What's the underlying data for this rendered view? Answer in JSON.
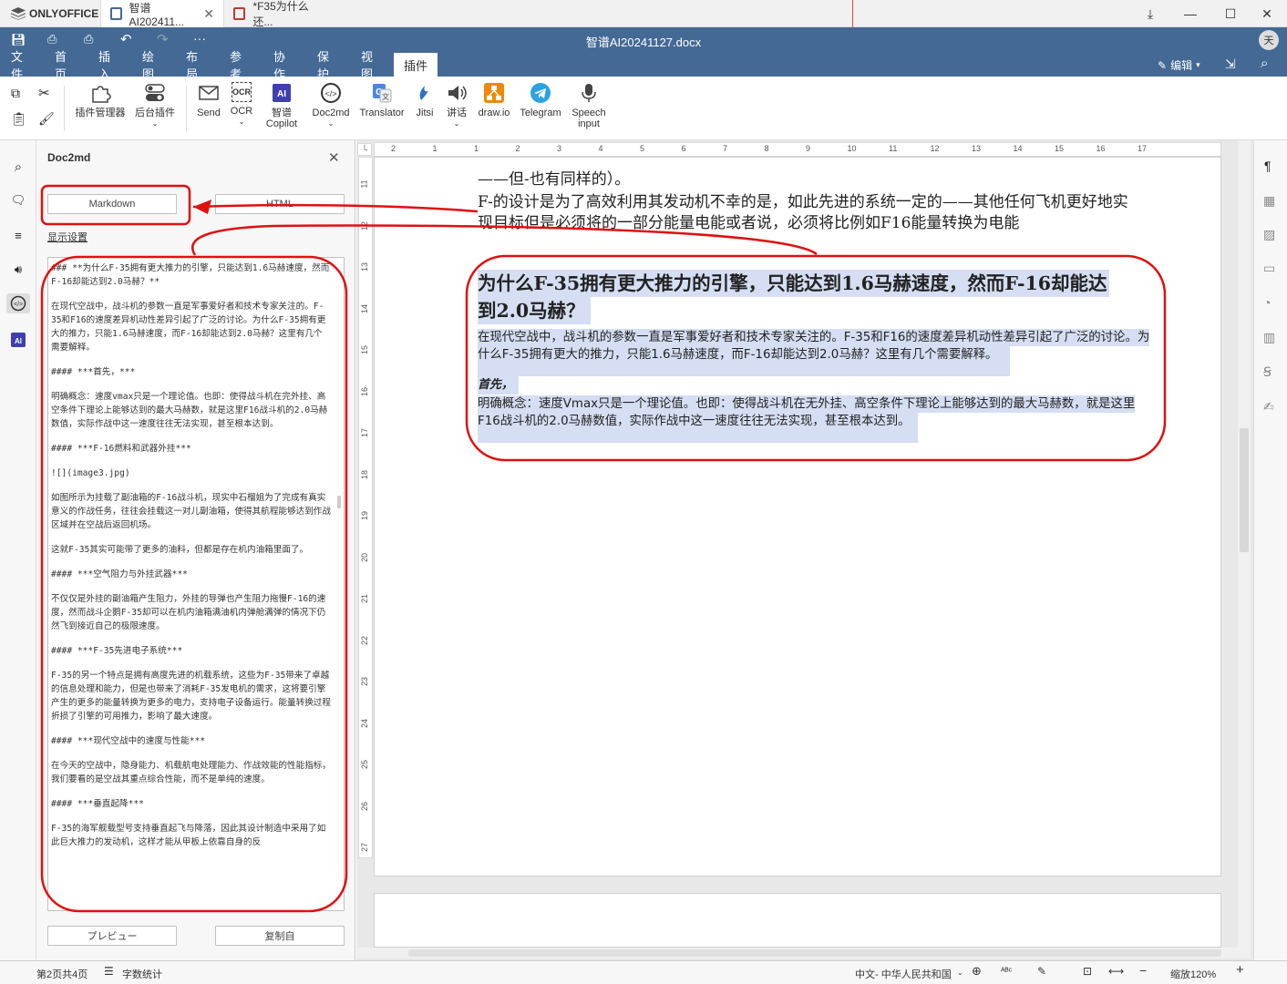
{
  "titlebar": {
    "app_name": "ONLYOFFICE",
    "tabs": [
      {
        "label": "智谱AI202411..."
      },
      {
        "label": "*F35为什么还..."
      }
    ]
  },
  "header": {
    "doc_title": "智谱AI20241127.docx",
    "avatar": "天",
    "edit_label": "编辑"
  },
  "menu": {
    "items": [
      "文件",
      "首页",
      "插入",
      "绘图",
      "布局",
      "参考",
      "协作",
      "保护",
      "视图",
      "插件"
    ],
    "active": "插件"
  },
  "toolbar": {
    "plugin_manager": "插件管理器",
    "background_plugins": "后台插件",
    "send": "Send",
    "ocr": "OCR",
    "zhipu_copilot_1": "智谱",
    "zhipu_copilot_2": "Copilot",
    "doc2md": "Doc2md",
    "translator": "Translator",
    "jitsi": "Jitsi",
    "speech": "讲话",
    "drawio": "draw.io",
    "telegram": "Telegram",
    "speech_input_1": "Speech",
    "speech_input_2": "input"
  },
  "panel": {
    "title": "Doc2md",
    "markdown_button": "Markdown",
    "html_button": "HTML",
    "display_settings": "显示设置",
    "preview_button": "プレビュー",
    "copy_button": "复制自",
    "markdown_blocks": [
      "### **为什么F-35拥有更大推力的引擎，只能达到1.6马赫速度，然而F-16却能达到2.0马赫？**",
      "在现代空战中，战斗机的参数一直是军事爱好者和技术专家关注的。F-35和F16的速度差异机动性差异引起了广泛的讨论。为什么F-35拥有更大的推力，只能1.6马赫速度，而F-16却能达到2.0马赫？这里有几个需要解释。",
      "#### ***首先，***",
      "明确概念：速度vmax只是一个理论值。也即：使得战斗机在完外挂、高空条件下理论上能够达到的最大马赫数，就是这里F16战斗机的2.0马赫数值，实际作战中这一速度往往无法实现，甚至根本达到。",
      "#### ***F-16燃料和武器外挂***",
      "![](image3.jpg)",
      "如图所示为挂载了副油箱的F-16战斗机，现实中石榴姐为了完成有真实意义的作战任务，往往会挂载这一对儿副油箱，使得其航程能够达到作战区域并在空战后返回机场。",
      "这就F-35其实可能带了更多的油料，但都是存在机内油箱里面了。",
      "#### ***空气阻力与外挂武器***",
      "不仅仅是外挂的副油箱产生阻力，外挂的导弹也产生阻力拖慢F-16的速度，然而战斗企鹅F-35却可以在机内油箱满油机内弹舱满弹的情况下仍然飞到接近自己的极限速度。",
      "#### ***F-35先进电子系统***",
      "F-35的另一个特点是拥有高度先进的机载系统，这些为F-35带来了卓越的信息处理和能力，但是也带来了消耗F-35发电机的需求，这将要引擎产生的更多的能量转换为更多的电力，支持电子设备运行。能量转换过程折损了引擎的可用推力，影响了最大速度。",
      "#### ***现代空战中的速度与性能***",
      "在今天的空战中，隐身能力、机载航电处理能力、作战效能的性能指标，我们要看的是空战其重点综合性能，而不是单纯的速度。",
      "#### ***垂直起降***",
      "F-35的海军舰载型号支持垂直起飞与降落，因此其设计制造中采用了如此巨大推力的发动机，这样才能从甲板上依靠自身的反"
    ]
  },
  "document": {
    "line1": "——但-也有同样的）。",
    "line2": "F-的设计是为了高效利用其发动机不幸的是，如此先进的系统一定的——其他任何飞机更好地实",
    "line3": "现目标但是必须将的一部分能量电能或者说，必须将比例如F16能量转换为电能",
    "heading_line1": "为什么F-35拥有更大推力的引擎，只能达到1.6马赫速度，然而F-16却能达",
    "heading_line2": "到2.0马赫？",
    "para1_line1": "在现代空战中，战斗机的参数一直是军事爱好者和技术专家关注的。F-35和F16的速度差异机动性差异引起了广泛的讨论。为",
    "para1_line2": "什么F-35拥有更大的推力，只能1.6马赫速度，而F-16却能达到2.0马赫？这里有几个需要解释。",
    "subheading": "首先，",
    "para2_line1": "明确概念：速度Vmax只是一个理论值。也即：使得战斗机在无外挂、高空条件下理论上能够达到的最大马赫数，就是这里",
    "para2_line2": "F16战斗机的2.0马赫数值，实际作战中这一速度往往无法实现，甚至根本达到。"
  },
  "ruler": {
    "h_ticks": [
      "2",
      "1",
      "1",
      "2",
      "3",
      "4",
      "5",
      "6",
      "7",
      "8",
      "9",
      "10",
      "11",
      "12",
      "13",
      "14",
      "15",
      "16",
      "17"
    ],
    "v_ticks": [
      "11",
      "12",
      "13",
      "14",
      "15",
      "16",
      "17",
      "18",
      "19",
      "20",
      "21",
      "22",
      "23",
      "24",
      "25",
      "26",
      "27"
    ]
  },
  "status": {
    "page": "第2页共4页",
    "word_count": "字数统计",
    "language": "中文- 中华人民共和国",
    "zoom": "缩放120%"
  },
  "colors": {
    "header_blue": "#446995",
    "annotation_red": "#e01010",
    "selection": "#d5def2"
  }
}
